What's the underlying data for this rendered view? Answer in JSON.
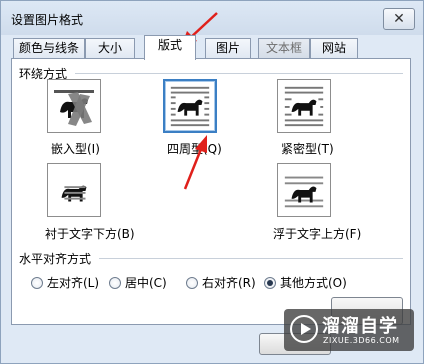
{
  "window": {
    "title": "设置图片格式",
    "close_glyph": "✕"
  },
  "tabs": [
    {
      "label": "颜色与线条",
      "state": "normal"
    },
    {
      "label": "大小",
      "state": "normal"
    },
    {
      "label": "版式",
      "state": "active"
    },
    {
      "label": "图片",
      "state": "normal"
    },
    {
      "label": "文本框",
      "state": "disabled"
    },
    {
      "label": "网站",
      "state": "normal"
    }
  ],
  "wrap_section": {
    "title": "环绕方式",
    "options": [
      {
        "label": "嵌入型(I)",
        "icon": "inline-wrap-icon",
        "selected": false
      },
      {
        "label": "四周型(Q)",
        "icon": "square-wrap-icon",
        "selected": true
      },
      {
        "label": "紧密型(T)",
        "icon": "tight-wrap-icon",
        "selected": false
      },
      {
        "label": "衬于文字下方(B)",
        "icon": "behind-text-icon",
        "selected": false
      },
      {
        "label": "浮于文字上方(F)",
        "icon": "in-front-text-icon",
        "selected": false
      }
    ]
  },
  "align_section": {
    "title": "水平对齐方式",
    "options": [
      {
        "label": "左对齐(L)",
        "checked": false
      },
      {
        "label": "居中(C)",
        "checked": false
      },
      {
        "label": "右对齐(R)",
        "checked": false
      },
      {
        "label": "其他方式(O)",
        "checked": true
      }
    ]
  },
  "watermark": {
    "text": "溜溜自学",
    "url": "ZIXUE.3D66.COM"
  },
  "colors": {
    "annotation_arrow": "#e0201b",
    "x_mark": "#7a7a7a",
    "selection_border": "#3b7fc4"
  }
}
